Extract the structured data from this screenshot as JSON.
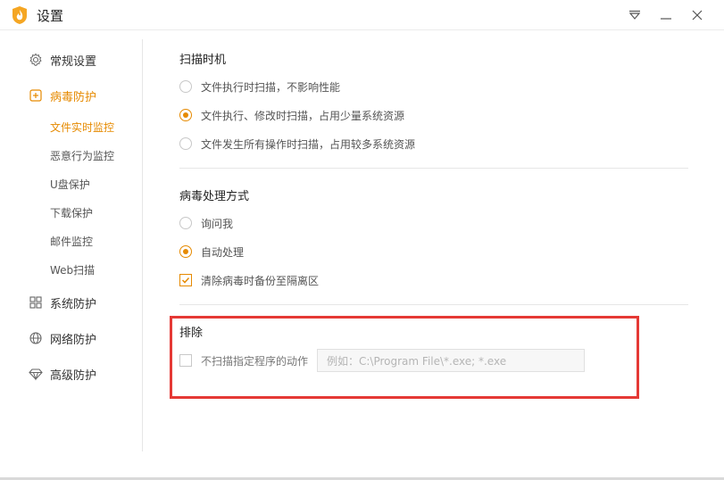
{
  "window": {
    "title": "设置",
    "accent_color": "#e68a00",
    "highlight_color": "#e53935"
  },
  "sidebar": {
    "items": [
      {
        "label": "常规设置",
        "icon": "gear-icon",
        "active": false
      },
      {
        "label": "病毒防护",
        "icon": "plus-square-icon",
        "active": true
      },
      {
        "label": "系统防护",
        "icon": "grid-icon",
        "active": false
      },
      {
        "label": "网络防护",
        "icon": "globe-icon",
        "active": false
      },
      {
        "label": "高级防护",
        "icon": "diamond-icon",
        "active": false
      }
    ],
    "sub_items": [
      {
        "label": "文件实时监控",
        "active": true
      },
      {
        "label": "恶意行为监控",
        "active": false
      },
      {
        "label": "U盘保护",
        "active": false
      },
      {
        "label": "下载保护",
        "active": false
      },
      {
        "label": "邮件监控",
        "active": false
      },
      {
        "label": "Web扫描",
        "active": false
      }
    ]
  },
  "scan_timing": {
    "title": "扫描时机",
    "options": [
      {
        "label": "文件执行时扫描，不影响性能",
        "checked": false
      },
      {
        "label": "文件执行、修改时扫描，占用少量系统资源",
        "checked": true
      },
      {
        "label": "文件发生所有操作时扫描，占用较多系统资源",
        "checked": false
      }
    ]
  },
  "virus_handling": {
    "title": "病毒处理方式",
    "options": [
      {
        "label": "询问我",
        "checked": false
      },
      {
        "label": "自动处理",
        "checked": true
      }
    ],
    "backup_label": "清除病毒时备份至隔离区",
    "backup_checked": true
  },
  "exclusion": {
    "title": "排除",
    "checkbox_label": "不扫描指定程序的动作",
    "checkbox_checked": false,
    "input_placeholder": "例如：C:\\Program File\\*.exe; *.exe"
  }
}
